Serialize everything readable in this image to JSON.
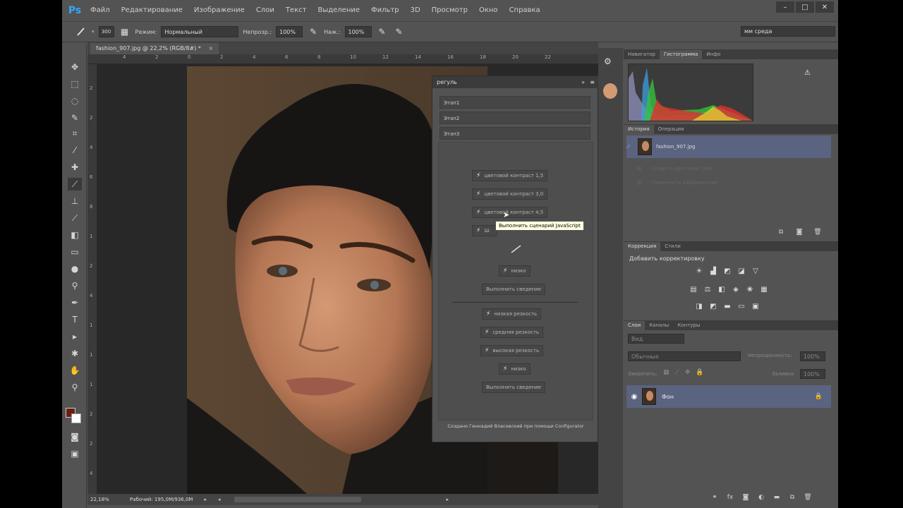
{
  "app": {
    "logo": "Ps"
  },
  "menu": [
    "Файл",
    "Редактирование",
    "Изображение",
    "Слои",
    "Текст",
    "Выделение",
    "Фильтр",
    "3D",
    "Просмотр",
    "Окно",
    "Справка"
  ],
  "window_buttons": [
    "–",
    "□",
    "✕"
  ],
  "options": {
    "brush_size": "300",
    "mode_label": "Режим:",
    "mode_value": "Нормальный",
    "opacity_label": "Непрозр.:",
    "opacity_value": "100%",
    "flow_label": "Наж.:",
    "flow_value": "100%",
    "workspace_value": "мм среда"
  },
  "document": {
    "tab_title": "fashion_907.jpg @ 22,2% (RGB/8#) *",
    "zoom": "22,18%",
    "status": "Рабочий: 195,0М/936,0М"
  },
  "ruler": {
    "h_ticks": [
      "4",
      "2",
      "0",
      "2",
      "4",
      "6",
      "8",
      "10",
      "12",
      "14",
      "16",
      "18",
      "20",
      "22"
    ],
    "v_ticks": [
      "2",
      "2",
      "4",
      "6",
      "8",
      "1",
      "2",
      "4",
      "1",
      "1",
      "1",
      "2",
      "2",
      "4"
    ]
  },
  "reg_panel": {
    "title": "регуль",
    "stages": [
      "Этап1",
      "Этап2",
      "Этап3"
    ],
    "actions_top": [
      "цветовой контраст 1,5",
      "цветовой контраст 3,0",
      "цветовой контраст 4,5"
    ],
    "action_partial": "Ш",
    "action_brush": "кисть",
    "action_noise1": "низко",
    "merge1": "Выполнить сведение",
    "actions_sharp": [
      "низкая резкость",
      "средняя резкость",
      "высокая резкость"
    ],
    "action_noise2": "низко",
    "merge2": "Выполнить сведение",
    "footer": "Создано Геннадий Власевский при помощи Configurator"
  },
  "tooltip": "Выполнить сценарий JavaScript",
  "panels": {
    "top_tabs": [
      "Навигатор",
      "Гистограмма",
      "Инфо"
    ],
    "history_tabs": [
      "История",
      "Операции"
    ],
    "history_items": [
      "fashion_907.jpg",
      "Создать цветовой слой",
      "Применить изображение"
    ],
    "adj_tabs": [
      "Коррекция",
      "Стили"
    ],
    "adj_title": "Добавить корректировку",
    "layers_tabs": [
      "Слои",
      "Каналы",
      "Контуры"
    ],
    "layer_kind": "Вид",
    "blend_mode": "Обычные",
    "opacity_label": "Непрозрачность:",
    "opacity_value": "100%",
    "lock_label": "Закрепить:",
    "fill_label": "Заливка:",
    "fill_value": "100%",
    "layer_name": "Фон"
  }
}
